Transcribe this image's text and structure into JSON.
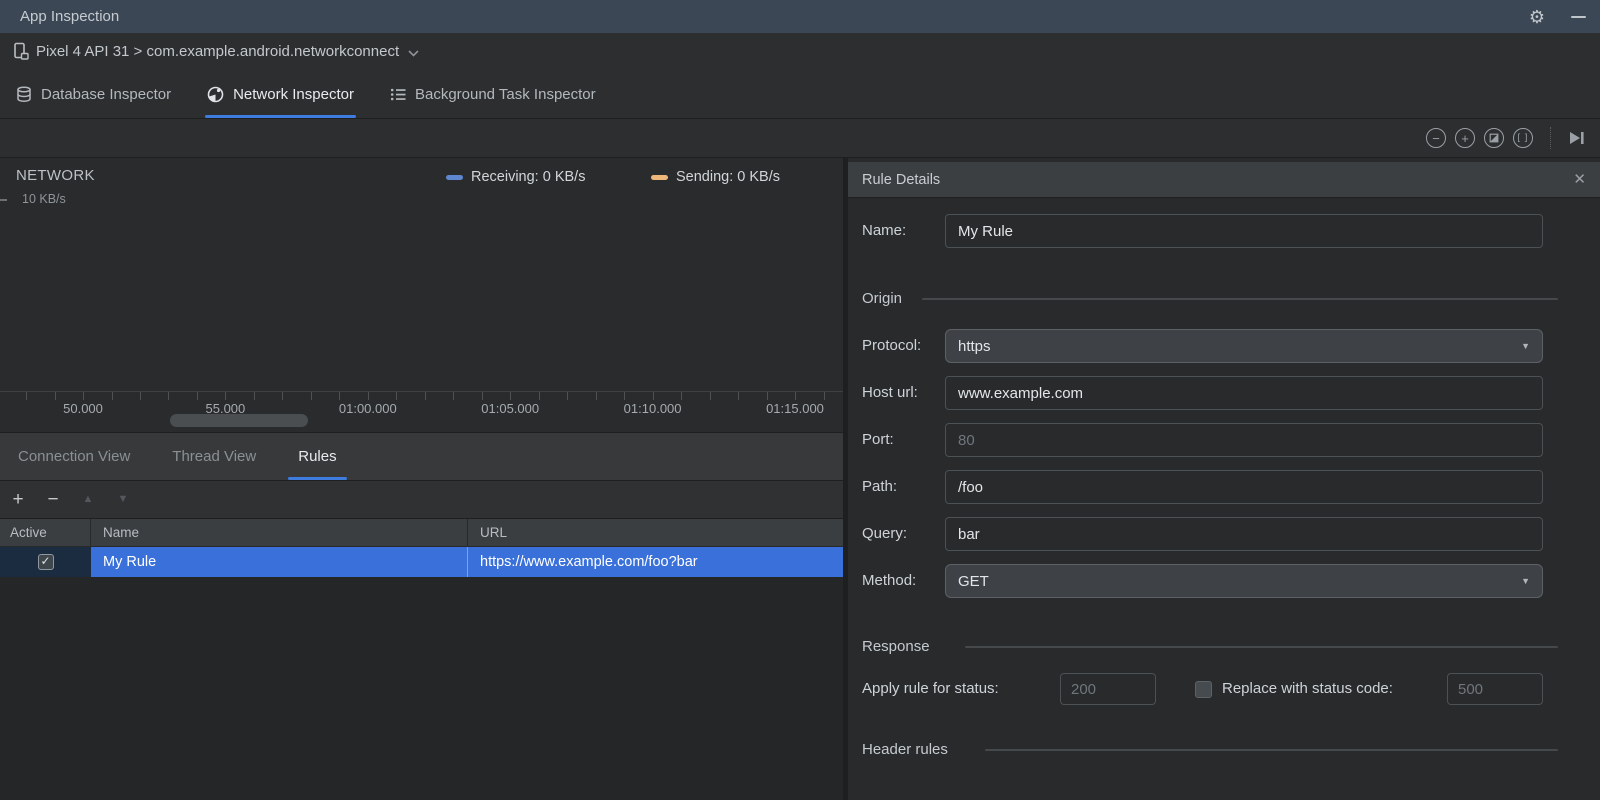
{
  "colors": {
    "titlebar_bg": "#3b4754",
    "accent_blue": "#3e7ce0",
    "selection_blue": "#3a70d9",
    "active_cell_bg": "#1c2c40",
    "receiving_color": "#5f87cf",
    "sending_color": "#eeb679",
    "panel_bg": "#292b2c",
    "details_bg": "#282a2c"
  },
  "titlebar": {
    "title": "App Inspection",
    "icons": [
      "settings-gear-icon",
      "minimize-icon"
    ]
  },
  "process_bar": {
    "label": "Pixel 4 API 31 > com.example.android.networkconnect",
    "device_icon": "phone-icon",
    "dropdown_icon": "chevron-down-icon"
  },
  "inspector_tabs": {
    "tabs": [
      {
        "label": "Database Inspector",
        "icon": "database-icon",
        "selected": false
      },
      {
        "label": "Network Inspector",
        "icon": "globe-icon",
        "selected": true
      },
      {
        "label": "Background Task Inspector",
        "icon": "task-list-icon",
        "selected": false
      }
    ]
  },
  "zoom_toolbar": {
    "icons": [
      "zoom-out-icon",
      "zoom-in-icon",
      "reset-zoom-icon",
      "zoom-to-selection-icon",
      "skip-to-end-icon"
    ]
  },
  "network": {
    "title": "NETWORK",
    "y_axis_top_label": "10 KB/s",
    "legend": [
      {
        "label": "Receiving: 0 KB/s",
        "color": "#5f87cf"
      },
      {
        "label": "Sending: 0 KB/s",
        "color": "#eeb679"
      }
    ],
    "chart_data": {
      "type": "line",
      "title": "NETWORK",
      "ylabel": "KB/s",
      "ylim": [
        0,
        10
      ],
      "y_tick_labels": [
        "10 KB/s"
      ],
      "x_tick_labels": [
        "50.000",
        "55.000",
        "01:00.000",
        "01:05.000",
        "01:10.000",
        "01:15.000"
      ],
      "series": [
        {
          "name": "Receiving",
          "current_rate": "0 KB/s",
          "color": "#5f87cf",
          "values": [
            0,
            0,
            0,
            0,
            0,
            0
          ]
        },
        {
          "name": "Sending",
          "current_rate": "0 KB/s",
          "color": "#eeb679",
          "values": [
            0,
            0,
            0,
            0,
            0,
            0
          ]
        }
      ],
      "grid": false,
      "legend_position": "top-right"
    },
    "tick_layout": {
      "first_major_x": 83,
      "major_spacing": 142.4,
      "minors_per_major": 5,
      "min_x": 20,
      "max_x": 828
    }
  },
  "rules_panel": {
    "tabs": [
      {
        "label": "Connection View",
        "selected": false
      },
      {
        "label": "Thread View",
        "selected": false
      },
      {
        "label": "Rules",
        "selected": true
      }
    ],
    "toolbar": [
      {
        "name": "add-rule",
        "glyph": "+",
        "enabled": true
      },
      {
        "name": "remove-rule",
        "glyph": "−",
        "enabled": true
      },
      {
        "name": "move-up",
        "glyph": "▲",
        "enabled": false
      },
      {
        "name": "move-down",
        "glyph": "▼",
        "enabled": false
      }
    ],
    "table": {
      "columns": [
        "Active",
        "Name",
        "URL"
      ],
      "rows": [
        {
          "active": true,
          "name": "My Rule",
          "url": "https://www.example.com/foo?bar",
          "selected": true
        }
      ]
    }
  },
  "rule_details": {
    "title": "Rule Details",
    "close_icon": "close-x-icon",
    "fields": {
      "name": {
        "label": "Name:",
        "value": "My Rule"
      },
      "protocol": {
        "label": "Protocol:",
        "value": "https",
        "type": "dropdown"
      },
      "host": {
        "label": "Host url:",
        "value": "www.example.com"
      },
      "port": {
        "label": "Port:",
        "placeholder": "80"
      },
      "path": {
        "label": "Path:",
        "value": "/foo"
      },
      "query": {
        "label": "Query:",
        "value": "bar"
      },
      "method": {
        "label": "Method:",
        "value": "GET",
        "type": "dropdown"
      }
    },
    "sections": {
      "origin": "Origin",
      "response": "Response",
      "header_rules": "Header rules"
    },
    "response": {
      "status_label": "Apply rule for status:",
      "status_placeholder": "200",
      "replace_checkbox_label": "Replace with status code:",
      "replace_checked": false,
      "replace_placeholder": "500"
    }
  }
}
